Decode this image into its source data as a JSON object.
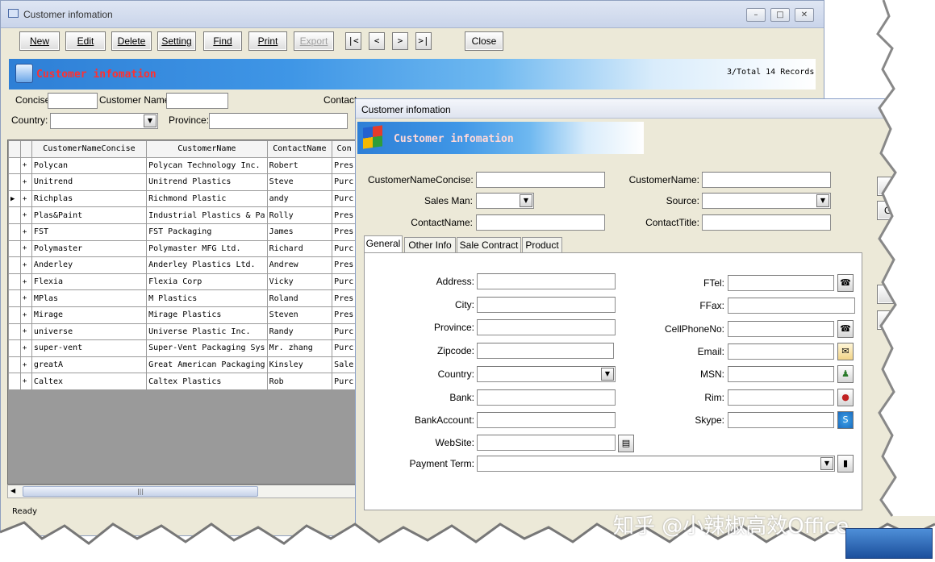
{
  "back_window": {
    "title": "Customer infomation",
    "toolbar": {
      "new": "New",
      "edit": "Edit",
      "delete": "Delete",
      "setting": "Setting",
      "find": "Find",
      "print": "Print",
      "export": "Export",
      "first": "|<",
      "prev": "<",
      "next": ">",
      "last": ">|",
      "close": "Close"
    },
    "banner_title": "Customer infomation",
    "record_count": "3/Total 14 Records",
    "filters": {
      "concise_label": "Concise",
      "customer_name_label": "Customer Name",
      "contact_label": "Contact",
      "country_label": "Country:",
      "province_label": "Province:"
    },
    "grid": {
      "columns": [
        "CustomerNameConcise",
        "CustomerName",
        "ContactName",
        "Con"
      ],
      "rows": [
        [
          "Polycan",
          "Polycan Technology Inc.",
          "Robert",
          "Pres"
        ],
        [
          "Unitrend",
          "Unitrend Plastics",
          "Steve",
          "Purc"
        ],
        [
          "Richplas",
          "Richmond Plastic",
          "andy",
          "Purc"
        ],
        [
          "Plas&Paint",
          "Industrial Plastics & Pa",
          "Rolly",
          "Pres"
        ],
        [
          "FST",
          "FST Packaging",
          "James",
          "Pres"
        ],
        [
          "Polymaster",
          "Polymaster MFG Ltd.",
          "Richard",
          "Purc"
        ],
        [
          "Anderley",
          "Anderley Plastics Ltd.",
          "Andrew",
          "Pres"
        ],
        [
          "Flexia",
          "Flexia Corp",
          "Vicky",
          "Purc"
        ],
        [
          "MPlas",
          "M Plastics",
          "Roland",
          "Pres"
        ],
        [
          "Mirage",
          "Mirage Plastics",
          "Steven",
          "Pres"
        ],
        [
          "universe",
          "Universe Plastic Inc.",
          "Randy",
          "Purc"
        ],
        [
          "super-vent",
          "Super-Vent Packaging Sys",
          "Mr. zhang",
          "Purc"
        ],
        [
          "greatA",
          "Great American Packaging",
          "Kinsley",
          "Sale"
        ],
        [
          "Caltex",
          "Caltex Plastics",
          "Rob",
          "Purc"
        ]
      ],
      "selected_row": 3
    },
    "status": "Ready"
  },
  "front_window": {
    "title": "Customer infomation",
    "banner_title": "Customer infomation",
    "header_fields": {
      "customer_name_concise": "CustomerNameConcise:",
      "customer_name": "CustomerName:",
      "sales_man": "Sales Man:",
      "source": "Source:",
      "contact_name": "ContactName:",
      "contact_title": "ContactTitle:"
    },
    "tabs": [
      "General",
      "Other Info",
      "Sale Contract",
      "Product"
    ],
    "general": {
      "address": "Address:",
      "city": "City:",
      "province": "Province:",
      "zipcode": "Zipcode:",
      "country": "Country:",
      "bank": "Bank:",
      "bank_account": "BankAccount:",
      "website": "WebSite:",
      "payment_term": "Payment Term:",
      "ftel": "FTel:",
      "ffax": "FFax:",
      "cellphone": "CellPhoneNo:",
      "email": "Email:",
      "msn": "MSN:",
      "rim": "Rim:",
      "skype": "Skype:"
    }
  },
  "watermark": "知乎 @小辣椒高效Office"
}
